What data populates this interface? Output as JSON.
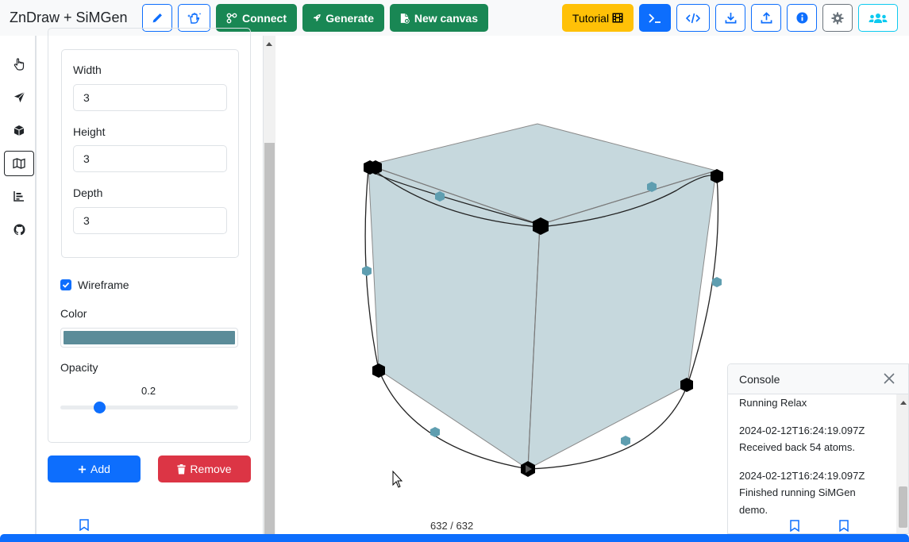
{
  "navbar": {
    "brand": "ZnDraw + SiMGen",
    "pencil_icon": "pencil-icon",
    "hand_icon": "hand-sparkles-icon",
    "connect": "Connect",
    "generate": "Generate",
    "new_canvas": "New canvas",
    "tutorial": "Tutorial",
    "terminal_icon": "terminal-icon",
    "code_icon": "code-icon",
    "download_icon": "download-icon",
    "upload_icon": "upload-icon",
    "info_icon": "info-icon",
    "gear_icon": "gear-icon",
    "users_icon": "users-icon"
  },
  "sidebar": {
    "icons": [
      "hand-pointer-icon",
      "paper-plane-icon",
      "cube-icon",
      "map-icon",
      "bar-chart-icon",
      "github-icon"
    ],
    "active_index": 3
  },
  "panel": {
    "width_label": "Width",
    "width_value": "3",
    "height_label": "Height",
    "height_value": "3",
    "depth_label": "Depth",
    "depth_value": "3",
    "wireframe_label": "Wireframe",
    "wireframe_checked": true,
    "color_label": "Color",
    "color_value": "#5b8c99",
    "opacity_label": "Opacity",
    "opacity_value": "0.2",
    "add_label": "Add",
    "remove_label": "Remove"
  },
  "viewport": {
    "frame_counter": "632 / 632"
  },
  "console": {
    "title": "Console",
    "lines": [
      "Running Relax",
      "",
      "2024-02-12T16:24:19.097Z",
      "Received back 54 atoms.",
      "",
      "2024-02-12T16:24:19.097Z",
      "Finished running SiMGen",
      "demo."
    ]
  },
  "colors": {
    "primary": "#0d6efd",
    "success": "#198754",
    "warning": "#ffc107",
    "danger": "#dc3545",
    "info": "#0dcaf0",
    "cube_fill": "#c6d8dd"
  }
}
